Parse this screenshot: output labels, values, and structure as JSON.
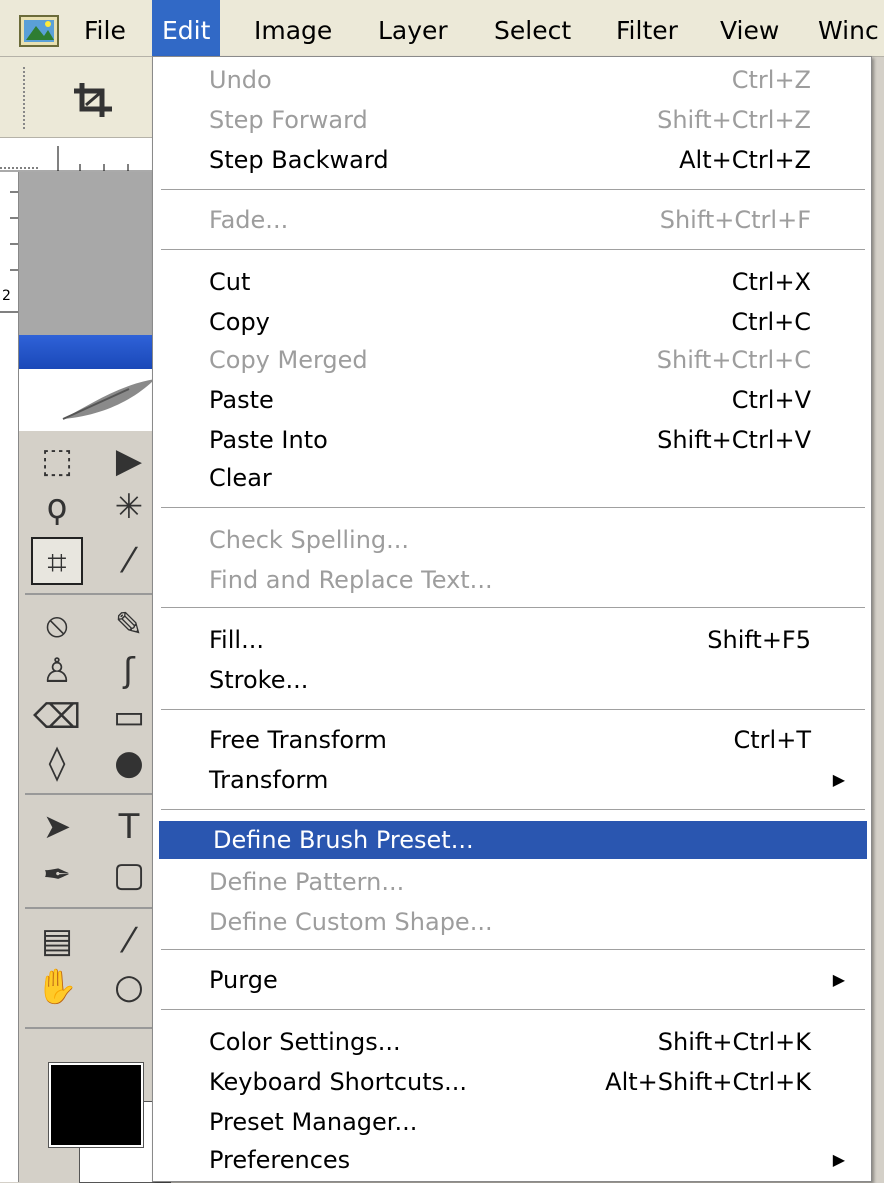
{
  "menubar": {
    "app_icon": "photoshop-app-icon",
    "items": [
      "File",
      "Edit",
      "Image",
      "Layer",
      "Select",
      "Filter",
      "View",
      "Winc"
    ],
    "active_index": 1,
    "active_color": "#3169c6"
  },
  "ruler": {
    "label_2": "2"
  },
  "edit_menu": {
    "highlight_color": "#2a56b0",
    "disabled_color": "#9d9d9d",
    "items": [
      {
        "label": "Undo",
        "shortcut": "Ctrl+Z",
        "disabled": true
      },
      {
        "label": "Step Forward",
        "shortcut": "Shift+Ctrl+Z",
        "disabled": true
      },
      {
        "label": "Step Backward",
        "shortcut": "Alt+Ctrl+Z",
        "disabled": false
      },
      {
        "label": "Fade...",
        "shortcut": "Shift+Ctrl+F",
        "disabled": true
      },
      {
        "label": "Cut",
        "shortcut": "Ctrl+X",
        "disabled": false
      },
      {
        "label": "Copy",
        "shortcut": "Ctrl+C",
        "disabled": false
      },
      {
        "label": "Copy Merged",
        "shortcut": "Shift+Ctrl+C",
        "disabled": true
      },
      {
        "label": "Paste",
        "shortcut": "Ctrl+V",
        "disabled": false
      },
      {
        "label": "Paste Into",
        "shortcut": "Shift+Ctrl+V",
        "disabled": false
      },
      {
        "label": "Clear",
        "shortcut": "",
        "disabled": false
      },
      {
        "label": "Check Spelling...",
        "shortcut": "",
        "disabled": true
      },
      {
        "label": "Find and Replace Text...",
        "shortcut": "",
        "disabled": true
      },
      {
        "label": "Fill...",
        "shortcut": "Shift+F5",
        "disabled": false
      },
      {
        "label": "Stroke...",
        "shortcut": "",
        "disabled": false
      },
      {
        "label": "Free Transform",
        "shortcut": "Ctrl+T",
        "disabled": false
      },
      {
        "label": "Transform",
        "shortcut": "",
        "disabled": false,
        "submenu": true
      },
      {
        "label": "Define Brush Preset...",
        "shortcut": "",
        "disabled": false,
        "highlighted": true
      },
      {
        "label": "Define Pattern...",
        "shortcut": "",
        "disabled": true
      },
      {
        "label": "Define Custom Shape...",
        "shortcut": "",
        "disabled": true
      },
      {
        "label": "Purge",
        "shortcut": "",
        "disabled": false,
        "submenu": true
      },
      {
        "label": "Color Settings...",
        "shortcut": "Shift+Ctrl+K",
        "disabled": false
      },
      {
        "label": "Keyboard Shortcuts...",
        "shortcut": "Alt+Shift+Ctrl+K",
        "disabled": false
      },
      {
        "label": "Preset Manager...",
        "shortcut": "",
        "disabled": false
      },
      {
        "label": "Preferences",
        "shortcut": "",
        "disabled": false,
        "submenu": true
      }
    ],
    "submenu_arrow": "▶"
  },
  "toolbox": {
    "tools": [
      {
        "icon": "marquee-icon",
        "glyph": "⬚"
      },
      {
        "icon": "move-icon",
        "glyph": "▶"
      },
      {
        "icon": "lasso-icon",
        "glyph": "ϙ"
      },
      {
        "icon": "magic-wand-icon",
        "glyph": "✳"
      },
      {
        "icon": "crop-icon",
        "glyph": "⌗"
      },
      {
        "icon": "slice-icon",
        "glyph": "⁄"
      },
      {
        "icon": "healing-brush-icon",
        "glyph": "⦸"
      },
      {
        "icon": "brush-icon",
        "glyph": "✎"
      },
      {
        "icon": "clone-stamp-icon",
        "glyph": "♙"
      },
      {
        "icon": "history-brush-icon",
        "glyph": "ʃ"
      },
      {
        "icon": "eraser-icon",
        "glyph": "⌫"
      },
      {
        "icon": "gradient-icon",
        "glyph": "▭"
      },
      {
        "icon": "blur-icon",
        "glyph": "◊"
      },
      {
        "icon": "dodge-icon",
        "glyph": "●"
      },
      {
        "icon": "path-selection-icon",
        "glyph": "➤"
      },
      {
        "icon": "type-icon",
        "glyph": "T"
      },
      {
        "icon": "pen-icon",
        "glyph": "✒"
      },
      {
        "icon": "shape-icon",
        "glyph": "▢"
      },
      {
        "icon": "notes-icon",
        "glyph": "▤"
      },
      {
        "icon": "eyedropper-icon",
        "glyph": "⁄"
      },
      {
        "icon": "hand-icon",
        "glyph": "✋"
      },
      {
        "icon": "zoom-icon",
        "glyph": "○"
      }
    ],
    "foreground_color": "#000000",
    "background_color": "#ffffff"
  }
}
